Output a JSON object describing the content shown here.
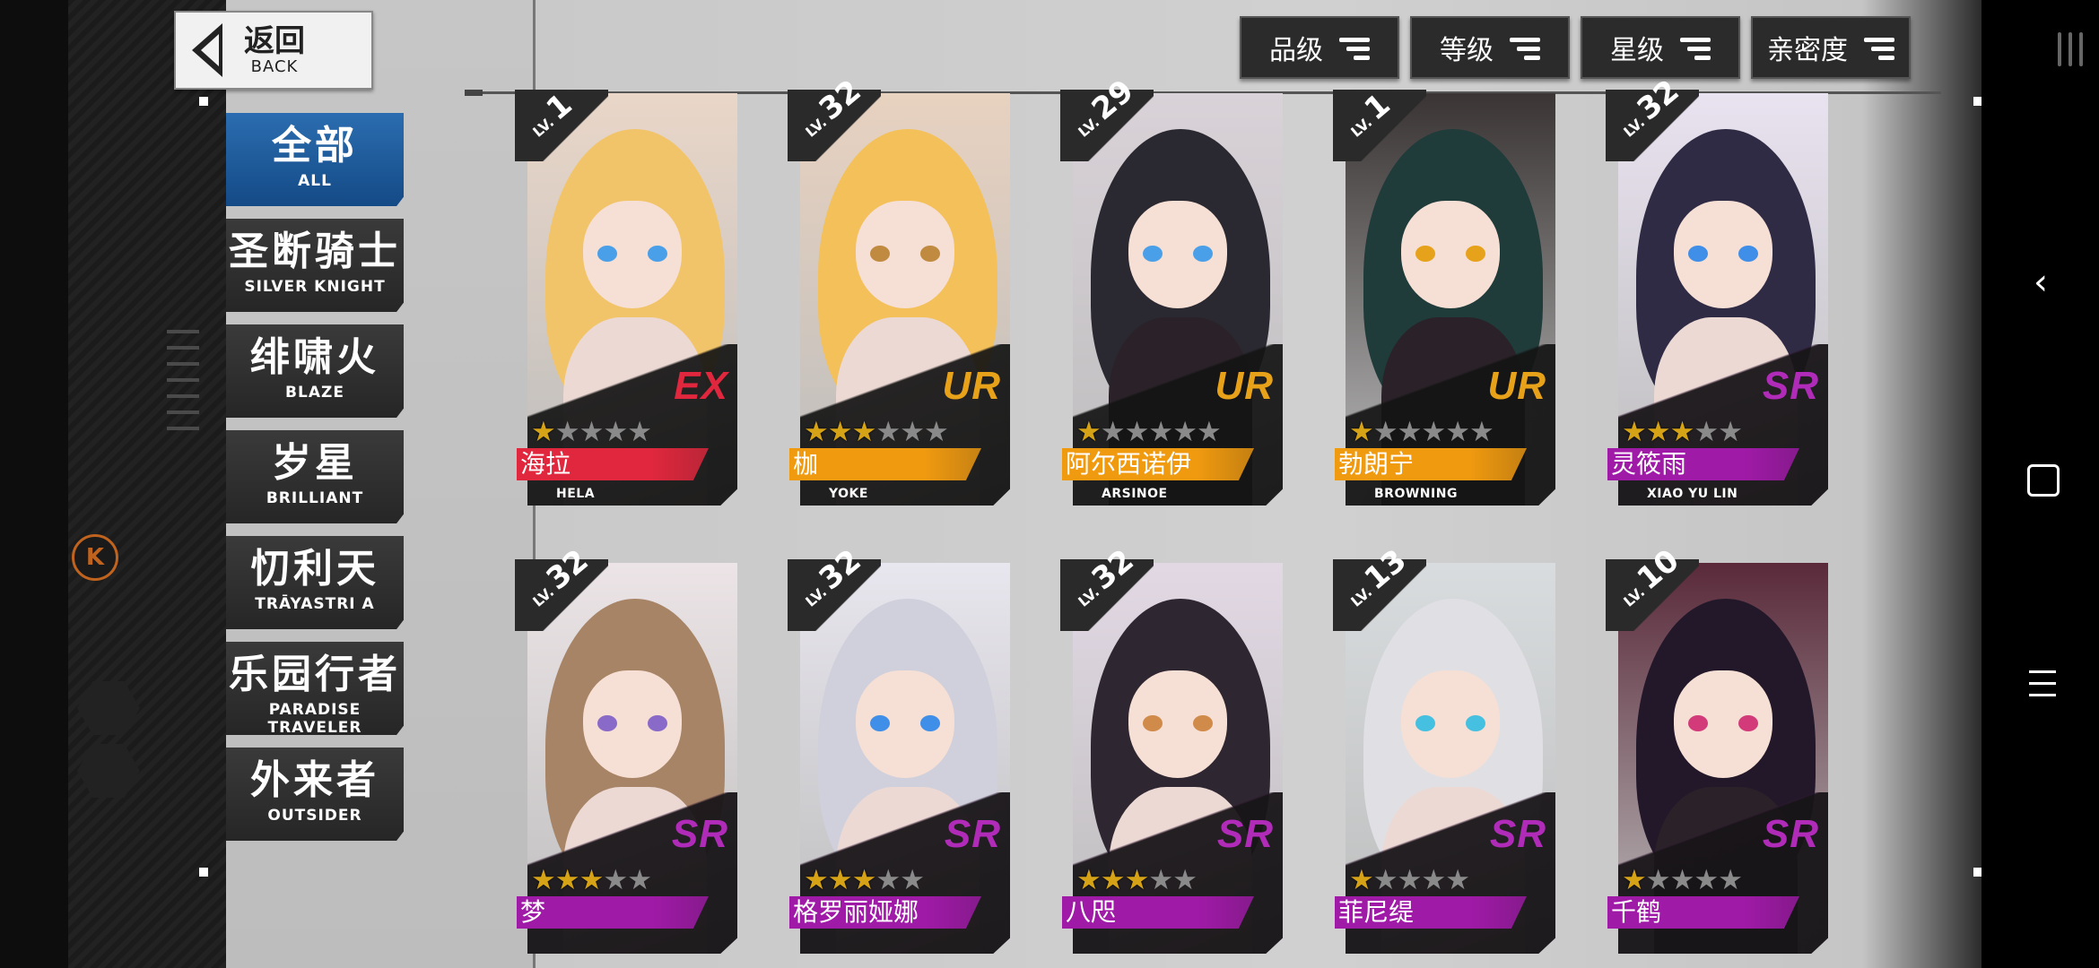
{
  "back_button": {
    "zh": "返回",
    "en": "BACK"
  },
  "categories": [
    {
      "zh": "全部",
      "en": "ALL"
    },
    {
      "zh": "圣断骑士",
      "en": "SILVER KNIGHT"
    },
    {
      "zh": "绯啸火",
      "en": "BLAZE"
    },
    {
      "zh": "岁星",
      "en": "BRILLIANT"
    },
    {
      "zh": "忉利天",
      "en": "TRĀYASTRI A"
    },
    {
      "zh": "乐园行者",
      "en": "PARADISE TRAVELER"
    },
    {
      "zh": "外来者",
      "en": "OUTSIDER"
    }
  ],
  "filters": [
    "品级",
    "等级",
    "星级",
    "亲密度"
  ],
  "lv_prefix": "LV.",
  "k_badge": "K",
  "cards": [
    {
      "level": "1",
      "rarity": "EX",
      "stars": 1,
      "max_stars": 5,
      "name_zh": "海拉",
      "name_en": "HELA",
      "color": "#e0273d"
    },
    {
      "level": "32",
      "rarity": "UR",
      "stars": 3,
      "max_stars": 6,
      "name_zh": "枷",
      "name_en": "YOKE",
      "color": "#f09a10"
    },
    {
      "level": "29",
      "rarity": "UR",
      "stars": 1,
      "max_stars": 6,
      "name_zh": "阿尔西诺伊",
      "name_en": "ARSINOE",
      "color": "#f09a10"
    },
    {
      "level": "1",
      "rarity": "UR",
      "stars": 1,
      "max_stars": 6,
      "name_zh": "勃朗宁",
      "name_en": "BROWNING",
      "color": "#f09a10"
    },
    {
      "level": "32",
      "rarity": "SR",
      "stars": 3,
      "max_stars": 5,
      "name_zh": "灵筱雨",
      "name_en": "XIAO YU LIN",
      "color": "#a01aa8"
    },
    {
      "level": "32",
      "rarity": "SR",
      "stars": 3,
      "max_stars": 5,
      "name_zh": "梦",
      "name_en": "",
      "color": "#a01aa8"
    },
    {
      "level": "32",
      "rarity": "SR",
      "stars": 3,
      "max_stars": 5,
      "name_zh": "格罗丽娅娜",
      "name_en": "",
      "color": "#a01aa8"
    },
    {
      "level": "32",
      "rarity": "SR",
      "stars": 3,
      "max_stars": 5,
      "name_zh": "八咫",
      "name_en": "",
      "color": "#a01aa8"
    },
    {
      "level": "13",
      "rarity": "SR",
      "stars": 1,
      "max_stars": 5,
      "name_zh": "菲尼缇",
      "name_en": "",
      "color": "#a01aa8"
    },
    {
      "level": "10",
      "rarity": "SR",
      "stars": 1,
      "max_stars": 5,
      "name_zh": "千鹤",
      "name_en": "",
      "color": "#a01aa8"
    }
  ],
  "colors": {
    "rarity_EX": "#e0273d",
    "rarity_UR": "#e8a21a",
    "rarity_SR": "#b02bb8",
    "active_tab": "#1f5c9e",
    "star_on": "#d6a317"
  }
}
